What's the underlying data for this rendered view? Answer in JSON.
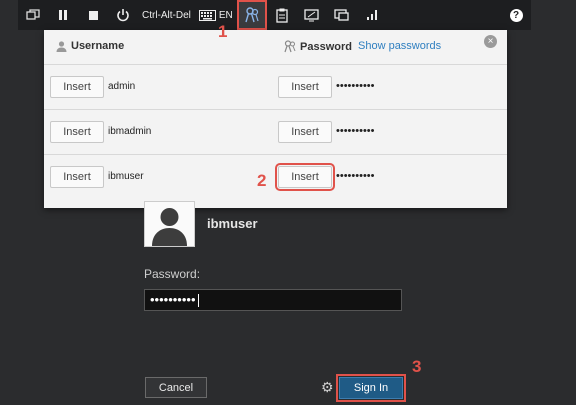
{
  "toolbar": {
    "ctrl_alt_del": "Ctrl-Alt-Del",
    "keyboard_lang": "EN",
    "help": "?",
    "icons": [
      "windows-icon",
      "pause-icon",
      "stop-icon",
      "power-icon",
      "keyboard-icon",
      "keys-icon",
      "clipboard-icon",
      "screen-icon",
      "display-icon",
      "signal-icon",
      "help-icon"
    ]
  },
  "popup": {
    "username_header": "Username",
    "password_header": "Password",
    "show_passwords": "Show passwords",
    "close": "×",
    "rows": [
      {
        "insert_user": "Insert",
        "username": "admin",
        "insert_pass": "Insert",
        "password": "••••••••••"
      },
      {
        "insert_user": "Insert",
        "username": "ibmadmin",
        "insert_pass": "Insert",
        "password": "••••••••••"
      },
      {
        "insert_user": "Insert",
        "username": "ibmuser",
        "insert_pass": "Insert",
        "password": "••••••••••"
      }
    ]
  },
  "login": {
    "username": "ibmuser",
    "password_label": "Password:",
    "password_value": "••••••••••",
    "cancel": "Cancel",
    "sign_in": "Sign In"
  },
  "callouts": {
    "one": "1",
    "two": "2",
    "three": "3"
  },
  "colors": {
    "accent": "#e0524a",
    "link": "#2f7fc0",
    "signin": "#1f5b86"
  }
}
